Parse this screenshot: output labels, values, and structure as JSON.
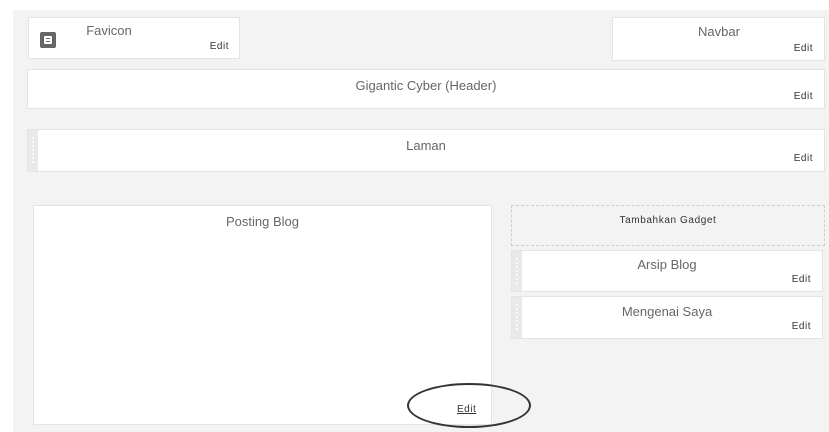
{
  "widgets": {
    "favicon": {
      "title": "Favicon",
      "edit_label": "Edit"
    },
    "navbar": {
      "title": "Navbar",
      "edit_label": "Edit"
    },
    "header": {
      "title": "Gigantic Cyber (Header)",
      "edit_label": "Edit"
    },
    "pages": {
      "title": "Laman",
      "edit_label": "Edit"
    },
    "blog_posts": {
      "title": "Posting Blog",
      "edit_label": "Edit"
    },
    "add_gadget": {
      "label": "Tambahkan Gadget"
    },
    "archive": {
      "title": "Arsip Blog",
      "edit_label": "Edit"
    },
    "about": {
      "title": "Mengenai Saya",
      "edit_label": "Edit"
    }
  },
  "icons": {
    "favicon": "blogger-logo-icon",
    "drag": "drag-handle-icon"
  },
  "colors": {
    "canvas_bg": "#f3f3f3",
    "widget_bg": "#ffffff",
    "border": "#e4e4e4",
    "highlight": "#333333"
  }
}
